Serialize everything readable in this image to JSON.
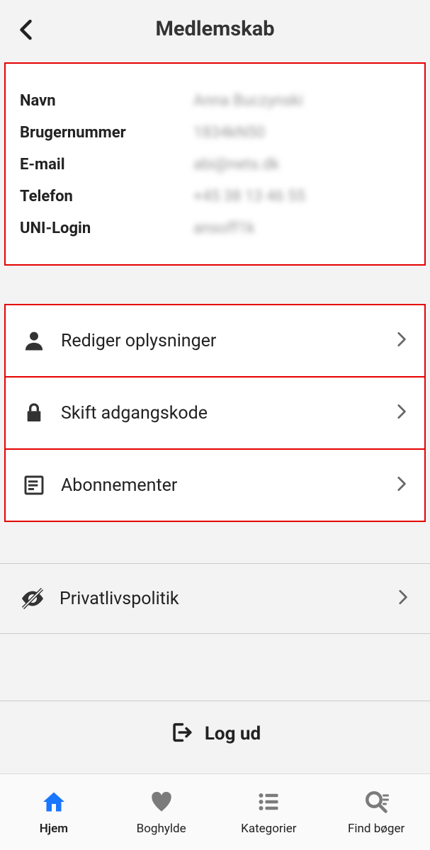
{
  "header": {
    "title": "Medlemskab"
  },
  "info": {
    "fields": [
      {
        "label": "Navn",
        "value": "Anna Buczynski"
      },
      {
        "label": "Brugernummer",
        "value": "1834kN50"
      },
      {
        "label": "E-mail",
        "value": "abi@nets.dk"
      },
      {
        "label": "Telefon",
        "value": "+45 38 13 46 55"
      },
      {
        "label": "UNI-Login",
        "value": "ansoff1k"
      }
    ]
  },
  "menu": {
    "items": [
      {
        "label": "Rediger oplysninger"
      },
      {
        "label": "Skift adgangskode"
      },
      {
        "label": "Abonnementer"
      }
    ]
  },
  "privacy": {
    "label": "Privatlivspolitik"
  },
  "logout": {
    "label": "Log ud"
  },
  "tabs": {
    "items": [
      {
        "label": "Hjem"
      },
      {
        "label": "Boghylde"
      },
      {
        "label": "Kategorier"
      },
      {
        "label": "Find bøger"
      }
    ]
  }
}
